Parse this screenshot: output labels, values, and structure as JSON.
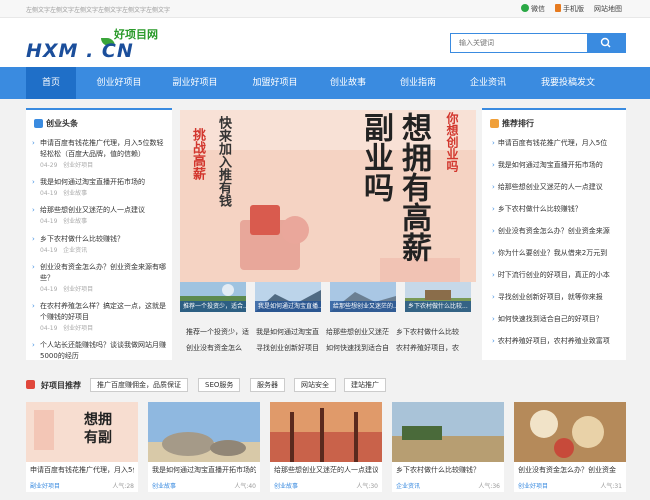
{
  "topbar": {
    "ticker": "左侧文字左侧文字左侧文字左侧文字左侧文字左侧文字",
    "links": [
      {
        "label": "微信",
        "icon": "wechat-icon",
        "color": "#2aa845"
      },
      {
        "label": "手机版",
        "icon": "mobile-icon",
        "color": "#e67a1f"
      },
      {
        "label": "网站地图",
        "icon": "",
        "color": ""
      }
    ]
  },
  "logo": {
    "cn": "好项目网",
    "en": "HXM . CN"
  },
  "search": {
    "placeholder": "输入关键词"
  },
  "nav": {
    "items": [
      {
        "label": "首页",
        "active": true
      },
      {
        "label": "创业好项目"
      },
      {
        "label": "副业好项目"
      },
      {
        "label": "加盟好项目"
      },
      {
        "label": "创业故事"
      },
      {
        "label": "创业指南"
      },
      {
        "label": "企业资讯"
      },
      {
        "label": "我要投稿发文"
      }
    ]
  },
  "left": {
    "title": "创业头条",
    "items": [
      {
        "title": "申请百度有钱花推广代理，月入5位数轻轻松松（百度大品牌，值的信赖）",
        "date": "04-29",
        "cat": "创业好项目"
      },
      {
        "title": "我是如何通过淘宝直播开拓市场的",
        "date": "04-19",
        "cat": "创业故事"
      },
      {
        "title": "给那些想创业又迷茫的人一点建议",
        "date": "04-19",
        "cat": "创业故事"
      },
      {
        "title": "乡下农村做什么比较赚钱？",
        "date": "04-19",
        "cat": "企业资讯"
      },
      {
        "title": "创业没有资金怎么办？创业资金来源有哪些？",
        "date": "04-19",
        "cat": "创业好项目"
      },
      {
        "title": "在农村养殖怎么样？搞定这一点，这就是个赚钱的好项目",
        "date": "04-19",
        "cat": "创业好项目"
      },
      {
        "title": "个人站长还能赚钱吗？谈谈我做网站月赚5000的经历",
        "date": "",
        "cat": ""
      }
    ]
  },
  "banner": {
    "left_texts": [
      "挑战高薪",
      "快来加入推有钱"
    ],
    "big": "想拥有高薪副业吗",
    "small": "你想创业吗"
  },
  "thumbs": [
    {
      "caption": "推荐一个投资少，适合..."
    },
    {
      "caption": "我是如何通过淘宝直播..."
    },
    {
      "caption": "给那些想创业又迷茫的..."
    },
    {
      "caption": "乡下农村做什么比较..."
    }
  ],
  "center_list": [
    [
      "推荐一个投资少，适",
      "我是如何通过淘宝直",
      "给那些想创业又迷茫",
      "乡下农村做什么比较"
    ],
    [
      "创业没有资金怎么",
      "寻找创业创新好项目",
      "如何快速找到适合自",
      "农村养殖好项目，农"
    ]
  ],
  "right": {
    "title": "推荐排行",
    "items": [
      "申请百度有钱花推广代理，月入5位",
      "我是如何通过淘宝直播开拓市场的",
      "给那些想创业又迷茫的人一点建议",
      "乡下农村做什么比较赚钱？",
      "创业没有资金怎么办？创业资金来源",
      "你为什么要创业？我从借来2万元到",
      "时下流行创业的好项目，真正的小本",
      "寻找创业创新好项目，就等你来报",
      "如何快速找到适合自己的好项目？",
      "农村养殖好项目，农村养殖业致富项"
    ]
  },
  "section2": {
    "title": "好项目推荐",
    "tags": [
      "推广百度赚佣金，品质保证",
      "SEO服务",
      "服务器",
      "网站安全",
      "建站推广"
    ]
  },
  "cards": [
    {
      "title": "申请百度有钱花推广代理，月入5位数",
      "cat": "副业好项目",
      "pop": "人气:28"
    },
    {
      "title": "我是如何通过淘宝直播开拓市场的",
      "cat": "创业故事",
      "pop": "人气:40"
    },
    {
      "title": "给那些想创业又迷茫的人一点建议",
      "cat": "创业故事",
      "pop": "人气:30"
    },
    {
      "title": "乡下农村做什么比较赚钱？",
      "cat": "企业资讯",
      "pop": "人气:36"
    },
    {
      "title": "创业没有资金怎么办？创业资金",
      "cat": "创业好项目",
      "pop": "人气:31"
    }
  ],
  "colors": {
    "accent": "#3a8be0",
    "nav_active": "#1f6fc8",
    "banner_text": "#d2362d"
  }
}
